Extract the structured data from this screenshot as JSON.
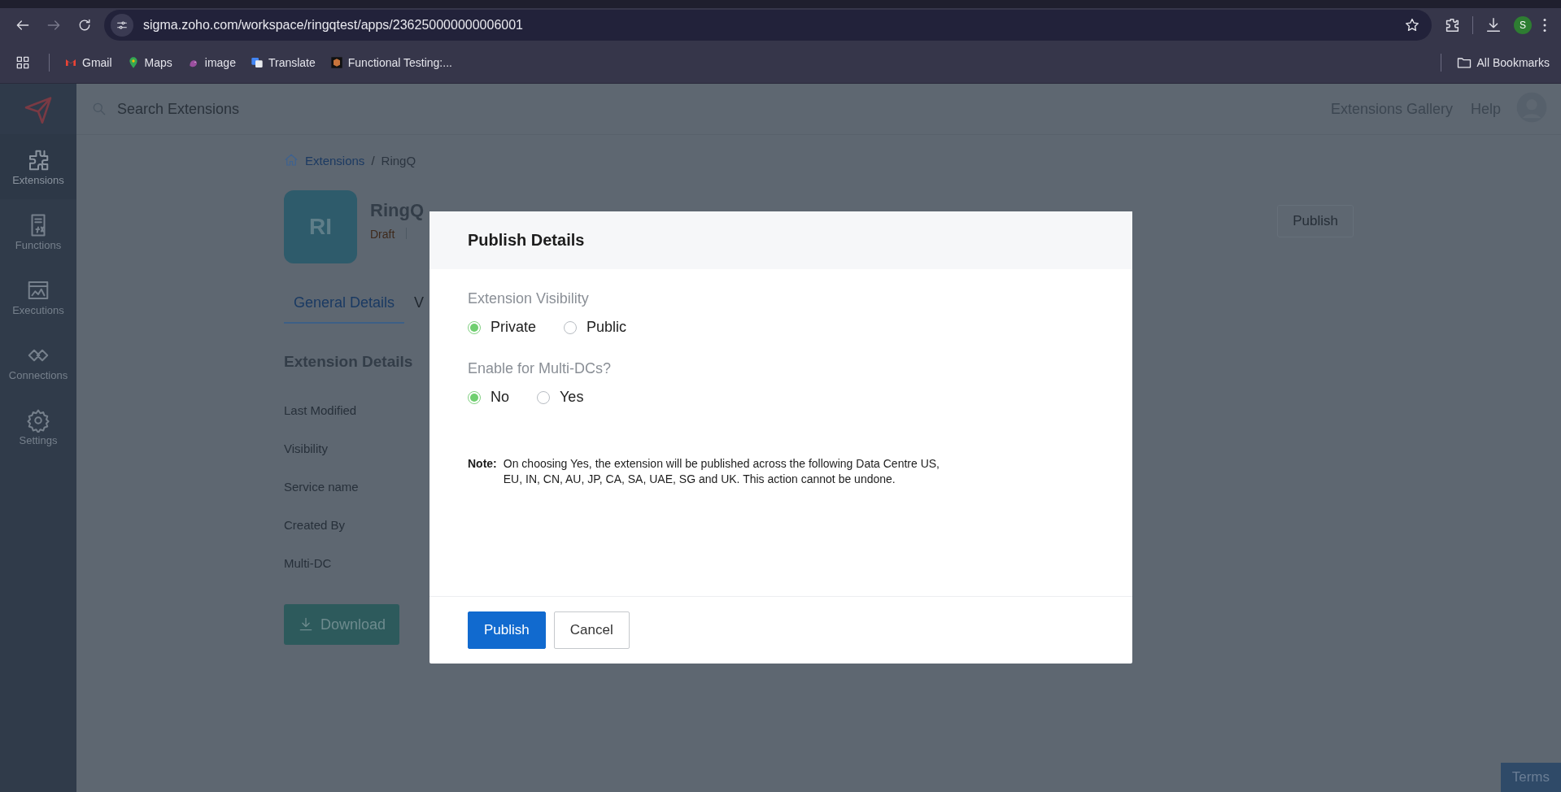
{
  "browser": {
    "url": "sigma.zoho.com/workspace/ringqtest/apps/236250000000006001",
    "profile_initial": "S",
    "bookmarks": [
      {
        "label": "Gmail",
        "kind": "gmail"
      },
      {
        "label": "Maps",
        "kind": "maps"
      },
      {
        "label": "image",
        "kind": "image"
      },
      {
        "label": "Translate",
        "kind": "translate"
      },
      {
        "label": "Functional Testing:...",
        "kind": "testing"
      }
    ],
    "all_bookmarks": "All Bookmarks"
  },
  "sidebar": {
    "items": [
      {
        "label": "Extensions",
        "kind": "extensions",
        "selected": true
      },
      {
        "label": "Functions",
        "kind": "functions",
        "selected": false
      },
      {
        "label": "Executions",
        "kind": "executions",
        "selected": false
      },
      {
        "label": "Connections",
        "kind": "connections",
        "selected": false
      },
      {
        "label": "Settings",
        "kind": "settings",
        "selected": false
      }
    ]
  },
  "header": {
    "search": {
      "placeholder": "Search Extensions"
    },
    "links": [
      "Extensions Gallery",
      "Help"
    ]
  },
  "breadcrumb": {
    "link": "Extensions",
    "separator": "/",
    "current": "RingQ"
  },
  "extension": {
    "initials": "RI",
    "name": "RingQ",
    "status": "Draft",
    "publish_button": "Publish"
  },
  "tabs": [
    {
      "label": "General Details",
      "selected": true
    },
    {
      "label": "V",
      "selected": false
    }
  ],
  "details": {
    "title": "Extension Details",
    "labels": [
      "Last Modified",
      "Visibility",
      "Service name",
      "Created By",
      "Multi-DC"
    ],
    "download_button": "Download"
  },
  "dialog": {
    "title": "Publish Details",
    "fields": [
      {
        "label": "Extension Visibility",
        "options": [
          {
            "label": "Private",
            "selected": true
          },
          {
            "label": "Public",
            "selected": false
          }
        ]
      },
      {
        "label": "Enable for Multi-DCs?",
        "options": [
          {
            "label": "No",
            "selected": true
          },
          {
            "label": "Yes",
            "selected": false
          }
        ]
      }
    ],
    "note": {
      "label": "Note:",
      "text": "On choosing Yes, the extension will be published across the following Data Centre US, EU, IN, CN, AU, JP, CA, SA, UAE, SG and UK. This action cannot be undone."
    },
    "buttons": [
      {
        "label": "Publish",
        "kind": "primary"
      },
      {
        "label": "Cancel",
        "kind": "secondary"
      }
    ]
  },
  "footer": {
    "terms": "Terms"
  }
}
